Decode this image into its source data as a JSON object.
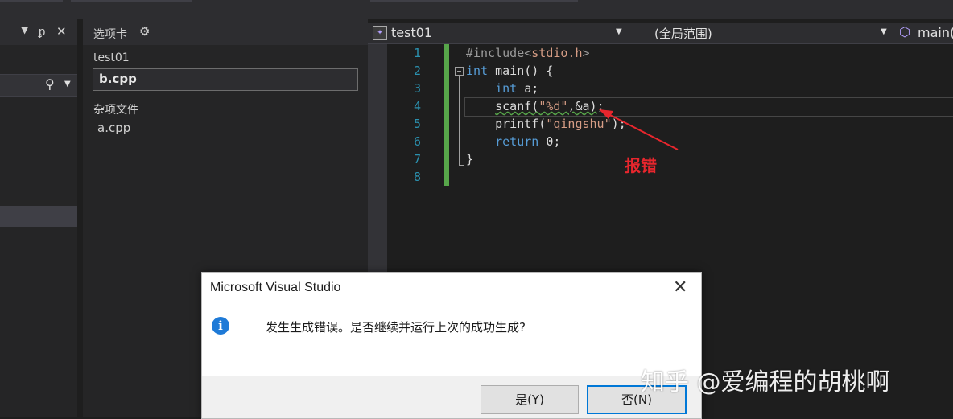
{
  "tab_pane": {
    "title": "选项卡",
    "items": [
      "test01",
      "b.cpp"
    ],
    "group": "杂项文件",
    "group_items": [
      "a.cpp"
    ]
  },
  "editor_header": {
    "project": "test01",
    "scope": "(全局范围)",
    "member": "main("
  },
  "code": {
    "line_numbers": [
      "1",
      "2",
      "3",
      "4",
      "5",
      "6",
      "7",
      "8"
    ]
  },
  "annotation": "报错",
  "dialog": {
    "title": "Microsoft Visual Studio",
    "message": "发生生成错误。是否继续并运行上次的成功生成?",
    "yes": "是(Y)",
    "no": "否(N)"
  },
  "watermark": "知乎 @爱编程的胡桃啊",
  "colors": {
    "accent": "#0078d7",
    "change_bar": "#57a64a",
    "annotation": "#e8262d"
  }
}
